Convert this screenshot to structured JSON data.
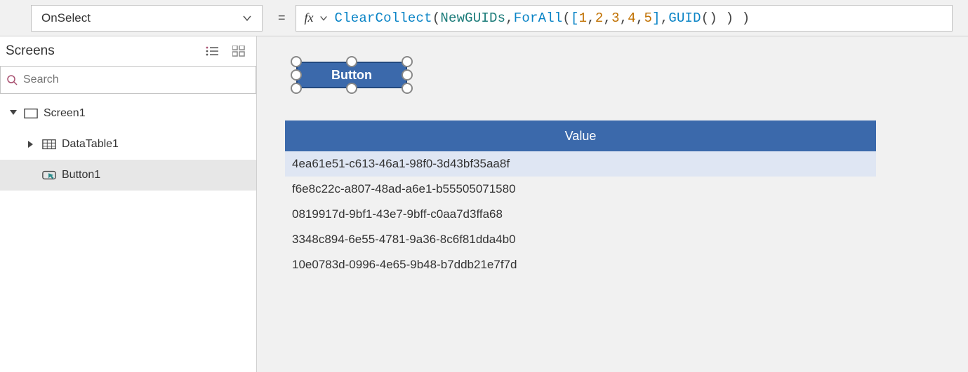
{
  "property_selector": {
    "value": "OnSelect"
  },
  "formula": {
    "tokens": [
      {
        "t": "ClearCollect",
        "cls": "tok-fn"
      },
      {
        "t": "( ",
        "cls": "tok-punc"
      },
      {
        "t": "NewGUIDs",
        "cls": "tok-var"
      },
      {
        "t": ", ",
        "cls": "tok-punc"
      },
      {
        "t": "ForAll",
        "cls": "tok-fn"
      },
      {
        "t": "( ",
        "cls": "tok-punc"
      },
      {
        "t": "[ ",
        "cls": "tok-arr"
      },
      {
        "t": "1",
        "cls": "tok-num"
      },
      {
        "t": ", ",
        "cls": "tok-punc"
      },
      {
        "t": "2",
        "cls": "tok-num"
      },
      {
        "t": ", ",
        "cls": "tok-punc"
      },
      {
        "t": "3",
        "cls": "tok-num"
      },
      {
        "t": ", ",
        "cls": "tok-punc"
      },
      {
        "t": "4",
        "cls": "tok-num"
      },
      {
        "t": ", ",
        "cls": "tok-punc"
      },
      {
        "t": "5",
        "cls": "tok-num"
      },
      {
        "t": " ]",
        "cls": "tok-arr"
      },
      {
        "t": ", ",
        "cls": "tok-punc"
      },
      {
        "t": "GUID",
        "cls": "tok-fn"
      },
      {
        "t": "() ) )",
        "cls": "tok-punc"
      }
    ]
  },
  "tree": {
    "title": "Screens",
    "search_placeholder": "Search",
    "items": [
      {
        "label": "Screen1",
        "type": "screen",
        "level": 0,
        "expanded": true
      },
      {
        "label": "DataTable1",
        "type": "datatable",
        "level": 1,
        "expanded": false
      },
      {
        "label": "Button1",
        "type": "button",
        "level": 1,
        "selected": true
      }
    ]
  },
  "canvas": {
    "button_text": "Button",
    "table": {
      "header": "Value",
      "rows": [
        "4ea61e51-c613-46a1-98f0-3d43bf35aa8f",
        "f6e8c22c-a807-48ad-a6e1-b55505071580",
        "0819917d-9bf1-43e7-9bff-c0aa7d3ffa68",
        "3348c894-6e55-4781-9a36-8c6f81dda4b0",
        "10e0783d-0996-4e65-9b48-b7ddb21e7f7d"
      ]
    }
  }
}
